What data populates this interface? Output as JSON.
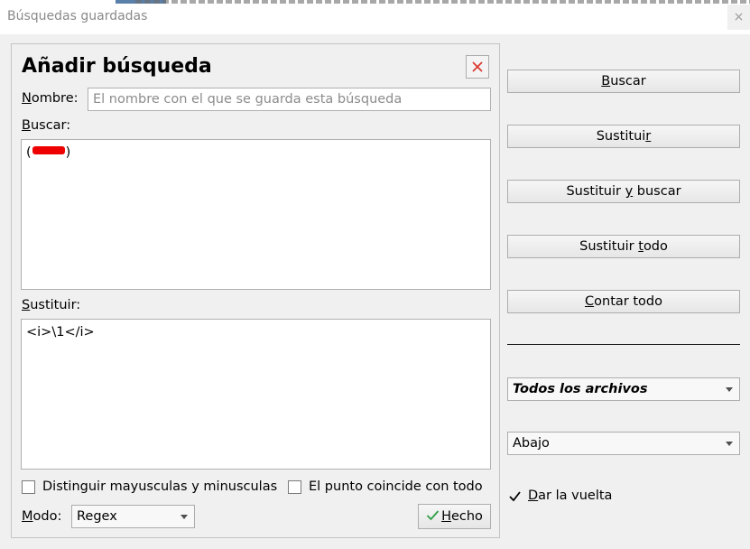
{
  "window": {
    "title": "Búsquedas guardadas",
    "close_glyph": "×"
  },
  "panel": {
    "title": "Añadir búsqueda",
    "close_icon": "close-x-icon",
    "name_label_first": "N",
    "name_label_rest": "ombre:",
    "name_placeholder": "El nombre con el que se guarda esta búsqueda",
    "name_value": "",
    "search_label_first": "B",
    "search_label_rest": "uscar:",
    "search_text_open": "(",
    "search_text_close": ")",
    "replace_label_first": "S",
    "replace_label_rest": "ustituir:",
    "replace_text": "<i>\\1</i>",
    "case_checkbox_label": "Distinguir mayusculas y minusculas",
    "case_checked": false,
    "dot_checkbox_label": "El punto coincide con todo",
    "dot_checked": false,
    "mode_label_first": "M",
    "mode_label_rest": "odo:",
    "mode_value": "Regex",
    "done_button_first": "H",
    "done_button_rest": "echo"
  },
  "actions": {
    "search": {
      "before": "",
      "key": "B",
      "after": "uscar"
    },
    "replace": {
      "before": "Sustitui",
      "key": "r",
      "after": ""
    },
    "replace_search": {
      "before": "Sustituir ",
      "key": "y",
      "after": " buscar"
    },
    "replace_all": {
      "before": "Sustituir ",
      "key": "t",
      "after": "odo"
    },
    "count_all": {
      "before": "",
      "key": "C",
      "after": "ontar todo"
    }
  },
  "scope": {
    "value": "Todos los archivos"
  },
  "direction": {
    "value": "Abajo"
  },
  "wrap": {
    "label_first": "D",
    "label_rest": "ar la vuelta",
    "checked": true
  },
  "colors": {
    "redaction": "#ee0000",
    "close_x": "#d9342b",
    "done_check": "#2e9e44"
  }
}
